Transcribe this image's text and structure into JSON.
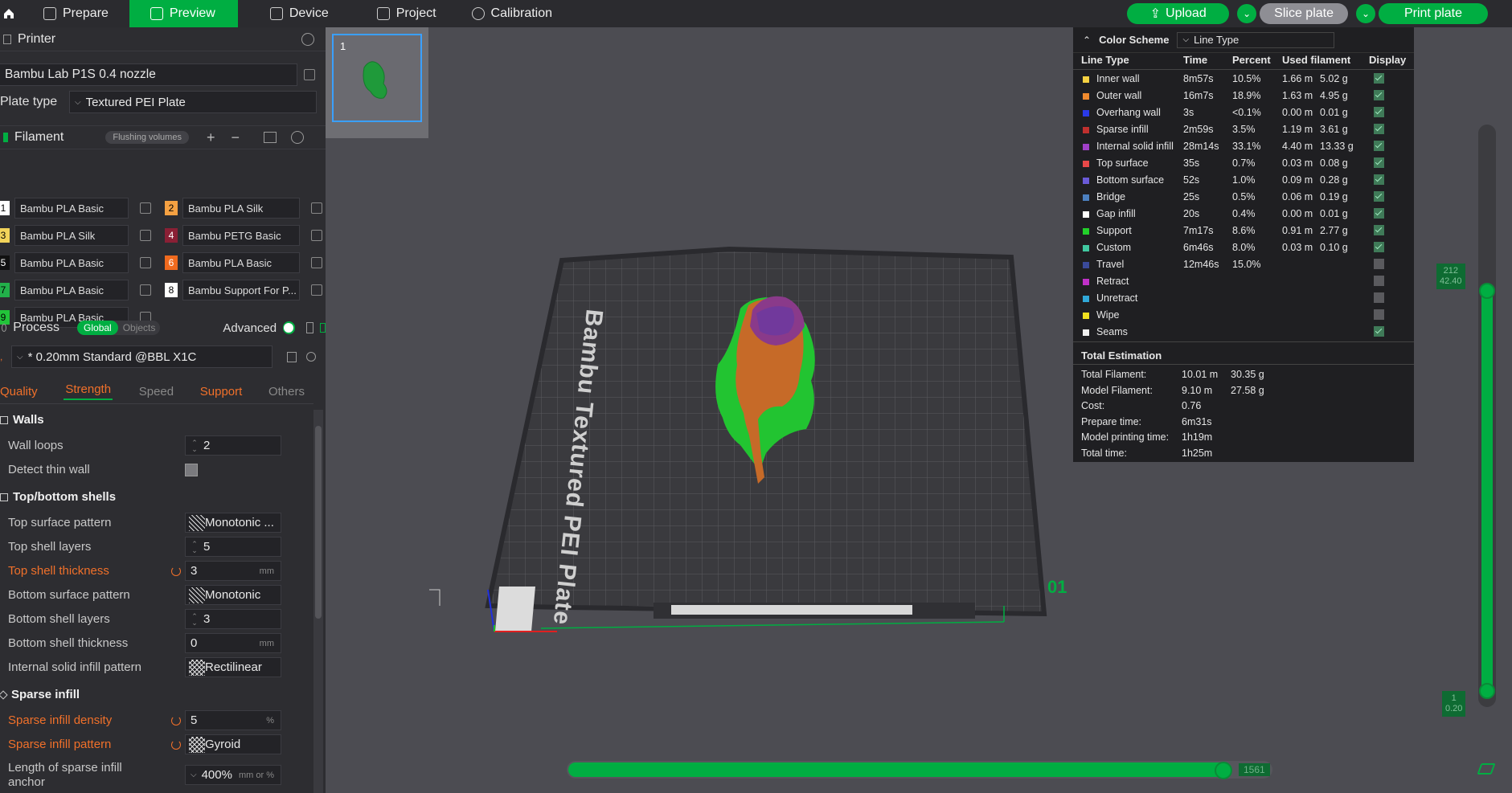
{
  "topbar": {
    "tabs": [
      "Prepare",
      "Preview",
      "Device",
      "Project",
      "Calibration"
    ],
    "active_tab": "Preview",
    "upload": "Upload",
    "slice_plate": "Slice plate",
    "print_plate": "Print plate",
    "accent": "#00ae42"
  },
  "printer": {
    "title": "Printer",
    "name": "Bambu Lab P1S 0.4 nozzle",
    "plate_label": "Plate type",
    "plate_value": "Textured PEI Plate"
  },
  "filament": {
    "title": "Filament",
    "flushing": "Flushing volumes",
    "items": [
      {
        "num": "1",
        "name": "Bambu PLA Basic",
        "color": "#ffffff"
      },
      {
        "num": "2",
        "name": "Bambu PLA Silk",
        "color": "#f5a142"
      },
      {
        "num": "3",
        "name": "Bambu PLA Silk",
        "color": "#f2d35a"
      },
      {
        "num": "4",
        "name": "Bambu PETG Basic",
        "color": "#8a2035"
      },
      {
        "num": "5",
        "name": "Bambu PLA Basic",
        "color": "#111111"
      },
      {
        "num": "6",
        "name": "Bambu PLA Basic",
        "color": "#f06a1e"
      },
      {
        "num": "7",
        "name": "Bambu PLA Basic",
        "color": "#22b04a"
      },
      {
        "num": "8",
        "name": "Bambu Support For P...",
        "color": "#ffffff"
      },
      {
        "num": "9",
        "name": "Bambu PLA Basic",
        "color": "#22c43a"
      }
    ]
  },
  "process": {
    "title": "Process",
    "global": "Global",
    "objects": "Objects",
    "advanced": "Advanced",
    "preset": "* 0.20mm Standard @BBL X1C",
    "tabs": [
      "Quality",
      "Strength",
      "Speed",
      "Support",
      "Others"
    ],
    "active_tab": "Strength"
  },
  "settings": {
    "walls": "Walls",
    "wall_loops": {
      "label": "Wall loops",
      "value": "2"
    },
    "detect_thin_wall": {
      "label": "Detect thin wall"
    },
    "top_bottom": "Top/bottom shells",
    "top_surface_pattern": {
      "label": "Top surface pattern",
      "value": "Monotonic ..."
    },
    "top_shell_layers": {
      "label": "Top shell layers",
      "value": "5"
    },
    "top_shell_thickness": {
      "label": "Top shell thickness",
      "value": "3",
      "unit": "mm"
    },
    "bottom_surface_pattern": {
      "label": "Bottom surface pattern",
      "value": "Monotonic"
    },
    "bottom_shell_layers": {
      "label": "Bottom shell layers",
      "value": "3"
    },
    "bottom_shell_thickness": {
      "label": "Bottom shell thickness",
      "value": "0",
      "unit": "mm"
    },
    "internal_solid_infill_pattern": {
      "label": "Internal solid infill pattern",
      "value": "Rectilinear"
    },
    "sparse_infill": "Sparse infill",
    "sparse_infill_density": {
      "label": "Sparse infill density",
      "value": "5",
      "unit": "%"
    },
    "sparse_infill_pattern": {
      "label": "Sparse infill pattern",
      "value": "Gyroid"
    },
    "anchor": {
      "label1": "Length of sparse infill",
      "label2": "anchor",
      "value": "400%",
      "unit": "mm or %"
    }
  },
  "plate_thumb": {
    "number": "1"
  },
  "viewport": {
    "bed_text": "Bambu Textured PEI Plate",
    "plate_number": "01",
    "vslider_top": "212\n42.40",
    "vslider_bottom": "1\n0.20",
    "hslider_value": "1561"
  },
  "legend": {
    "title": "Color Scheme",
    "scheme": "Line Type",
    "headers": [
      "Line Type",
      "Time",
      "Percent",
      "Used filament",
      "Display"
    ],
    "rows": [
      {
        "name": "Inner wall",
        "color": "#f5d142",
        "time": "8m57s",
        "pct": "10.5%",
        "len": "1.66 m",
        "g": "5.02 g",
        "on": true
      },
      {
        "name": "Outer wall",
        "color": "#f08a2e",
        "time": "16m7s",
        "pct": "18.9%",
        "len": "1.63 m",
        "g": "4.95 g",
        "on": true
      },
      {
        "name": "Overhang wall",
        "color": "#2a3ae8",
        "time": "3s",
        "pct": "<0.1%",
        "len": "0.00 m",
        "g": "0.01 g",
        "on": true
      },
      {
        "name": "Sparse infill",
        "color": "#c0302e",
        "time": "2m59s",
        "pct": "3.5%",
        "len": "1.19 m",
        "g": "3.61 g",
        "on": true
      },
      {
        "name": "Internal solid infill",
        "color": "#a040c8",
        "time": "28m14s",
        "pct": "33.1%",
        "len": "4.40 m",
        "g": "13.33 g",
        "on": true
      },
      {
        "name": "Top surface",
        "color": "#e84848",
        "time": "35s",
        "pct": "0.7%",
        "len": "0.03 m",
        "g": "0.08 g",
        "on": true
      },
      {
        "name": "Bottom surface",
        "color": "#6a5ad8",
        "time": "52s",
        "pct": "1.0%",
        "len": "0.09 m",
        "g": "0.28 g",
        "on": true
      },
      {
        "name": "Bridge",
        "color": "#4c80c0",
        "time": "25s",
        "pct": "0.5%",
        "len": "0.06 m",
        "g": "0.19 g",
        "on": true
      },
      {
        "name": "Gap infill",
        "color": "#ffffff",
        "time": "20s",
        "pct": "0.4%",
        "len": "0.00 m",
        "g": "0.01 g",
        "on": true
      },
      {
        "name": "Support",
        "color": "#22d02a",
        "time": "7m17s",
        "pct": "8.6%",
        "len": "0.91 m",
        "g": "2.77 g",
        "on": true
      },
      {
        "name": "Custom",
        "color": "#40c8a0",
        "time": "6m46s",
        "pct": "8.0%",
        "len": "0.03 m",
        "g": "0.10 g",
        "on": true
      },
      {
        "name": "Travel",
        "color": "#3a4a9a",
        "time": "12m46s",
        "pct": "15.0%",
        "len": "",
        "g": "",
        "on": false
      },
      {
        "name": "Retract",
        "color": "#c030c8",
        "time": "",
        "pct": "",
        "len": "",
        "g": "",
        "on": false
      },
      {
        "name": "Unretract",
        "color": "#30a8d8",
        "time": "",
        "pct": "",
        "len": "",
        "g": "",
        "on": false
      },
      {
        "name": "Wipe",
        "color": "#f0e020",
        "time": "",
        "pct": "",
        "len": "",
        "g": "",
        "on": false
      },
      {
        "name": "Seams",
        "color": "#f0f0f0",
        "time": "",
        "pct": "",
        "len": "",
        "g": "",
        "on": true
      }
    ],
    "estimation_title": "Total Estimation",
    "estimation": [
      {
        "label": "Total Filament:",
        "v1": "10.01 m",
        "v2": "30.35 g"
      },
      {
        "label": "Model Filament:",
        "v1": "9.10 m",
        "v2": "27.58 g"
      },
      {
        "label": "Cost:",
        "v1": "0.76",
        "v2": ""
      },
      {
        "label": "Prepare time:",
        "v1": "6m31s",
        "v2": ""
      },
      {
        "label": "Model printing time:",
        "v1": "1h19m",
        "v2": ""
      },
      {
        "label": "Total time:",
        "v1": "1h25m",
        "v2": ""
      }
    ]
  }
}
